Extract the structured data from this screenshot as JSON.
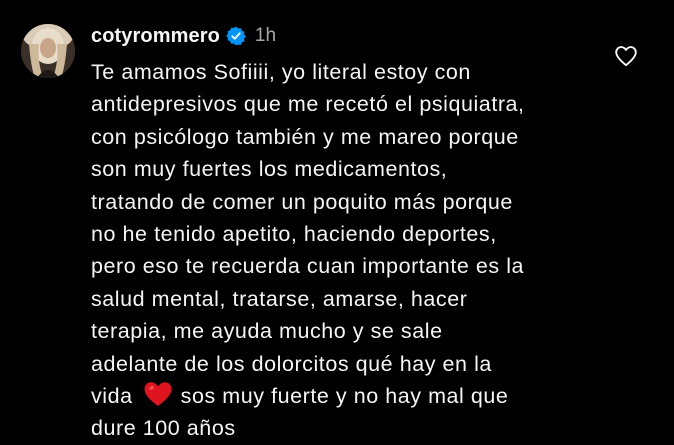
{
  "comment": {
    "username": "cotyrommero",
    "timestamp": "1h",
    "verified_icon": "verified-badge-icon",
    "like_icon": "heart-outline-icon",
    "emoji_icon": "red-heart-emoji",
    "lines": [
      "Te amamos Sofiiii, yo literal estoy con",
      "antidepresivos que me recetó el psiquiatra,",
      "con psicólogo también y me mareo porque",
      "son muy fuertes los medicamentos,",
      "tratando de comer un poquito más porque",
      "no he tenido apetito, haciendo deportes,",
      "pero eso te recuerda cuan importante es la",
      "salud mental, tratarse, amarse, hacer",
      "terapia, me ayuda mucho y se sale",
      "adelante de los dolorcitos qué hay en la"
    ],
    "line_vida": "vida",
    "line_after_heart": "sos muy fuerte y no hay mal que",
    "last_line": "dure 100 años"
  },
  "colors": {
    "background": "#000000",
    "text": "#f5f5f5",
    "muted": "#a8a8a8",
    "verified": "#0095f6",
    "heart_emoji": "#e0141e"
  }
}
